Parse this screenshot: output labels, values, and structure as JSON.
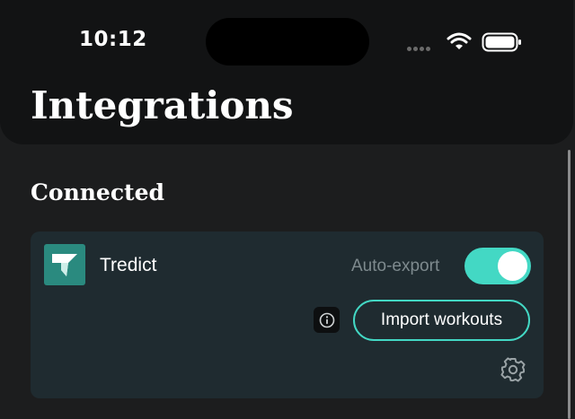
{
  "status_bar": {
    "time": "10:12",
    "icons": [
      "cellular-signal-icon",
      "wifi-icon",
      "battery-icon"
    ]
  },
  "header": {
    "title": "Integrations"
  },
  "section": {
    "title": "Connected"
  },
  "integration": {
    "name": "Tredict",
    "logo_icon": "tredict-logo-icon",
    "auto_export_label": "Auto-export",
    "auto_export_enabled": true,
    "import_button_label": "Import workouts",
    "info_icon": "info-icon",
    "settings_icon": "gear-icon"
  },
  "colors": {
    "accent": "#43d8c4",
    "card_background": "#1f2b30",
    "page_background": "#1c1d1e",
    "header_background": "#121314",
    "logo_background": "#2a8a7f",
    "muted_text": "#7e8a8e"
  }
}
